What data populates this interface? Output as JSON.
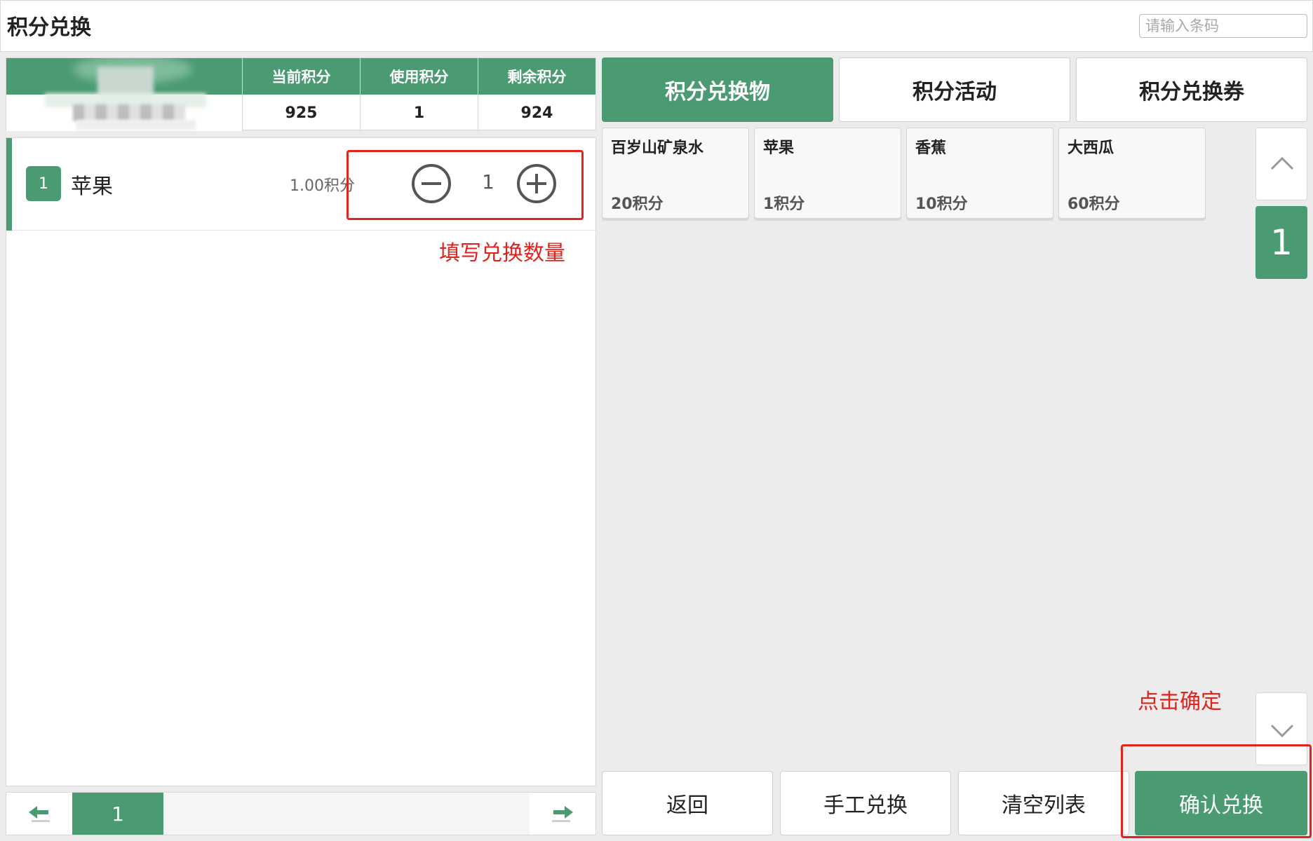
{
  "header": {
    "title": "积分兑换",
    "barcode_placeholder": "请输入条码"
  },
  "member": {
    "stats": [
      {
        "label": "当前积分",
        "value": "925"
      },
      {
        "label": "使用积分",
        "value": "1"
      },
      {
        "label": "剩余积分",
        "value": "924"
      }
    ]
  },
  "cart": {
    "items": [
      {
        "index": "1",
        "name": "苹果",
        "points": "1.00积分",
        "quantity": "1"
      }
    ],
    "annotation_quantity": "填写兑换数量"
  },
  "pager": {
    "current_page": "1"
  },
  "tabs": [
    {
      "label": "积分兑换物",
      "active": true
    },
    {
      "label": "积分活动",
      "active": false
    },
    {
      "label": "积分兑换券",
      "active": false
    }
  ],
  "products": [
    {
      "name": "百岁山矿泉水",
      "price": "20积分"
    },
    {
      "name": "苹果",
      "price": "1积分"
    },
    {
      "name": "香蕉",
      "price": "10积分"
    },
    {
      "name": "大西瓜",
      "price": "60积分"
    }
  ],
  "product_pager": {
    "current_page": "1"
  },
  "actions": {
    "back": "返回",
    "manual": "手工兑换",
    "clear": "清空列表",
    "confirm": "确认兑换",
    "annotation_confirm": "点击确定"
  },
  "colors": {
    "accent": "#4a9a72",
    "annotation": "#e0231c"
  },
  "icons": {
    "pager_prev": "arrow-left-icon",
    "pager_next": "arrow-right-icon",
    "side_up": "chevron-up-icon",
    "side_down": "chevron-down-icon",
    "qty_minus": "minus-circle-icon",
    "qty_plus": "plus-circle-icon"
  }
}
